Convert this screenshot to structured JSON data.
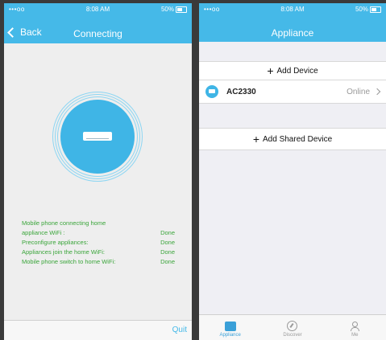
{
  "left_screen": {
    "status": {
      "carrier": "•••oo",
      "time": "8:08 AM",
      "battery": "50%"
    },
    "nav": {
      "back_label": "Back",
      "title": "Connecting"
    },
    "steps": [
      {
        "label": "Mobile phone connecting home",
        "status": ""
      },
      {
        "label": "appliance WiFi :",
        "status": "Done"
      },
      {
        "label": "Preconfigure appliances:",
        "status": "Done"
      },
      {
        "label": "Appliances join the home WiFi:",
        "status": "Done"
      },
      {
        "label": "Mobile phone switch to home WiFi:",
        "status": "Done"
      }
    ],
    "quit_label": "Quit"
  },
  "right_screen": {
    "status": {
      "carrier": "•••oo",
      "time": "8:08 AM",
      "battery": "50%"
    },
    "nav": {
      "title": "Appliance"
    },
    "add_device_label": "Add Device",
    "device": {
      "name": "AC2330",
      "status": "Online"
    },
    "add_shared_label": "Add Shared Device",
    "tabs": [
      {
        "label": "Appliance",
        "icon": "appliance-icon"
      },
      {
        "label": "Discover",
        "icon": "compass-icon"
      },
      {
        "label": "Me",
        "icon": "user-icon"
      }
    ]
  },
  "colors": {
    "accent": "#45b9e8",
    "success": "#3aa53a"
  }
}
